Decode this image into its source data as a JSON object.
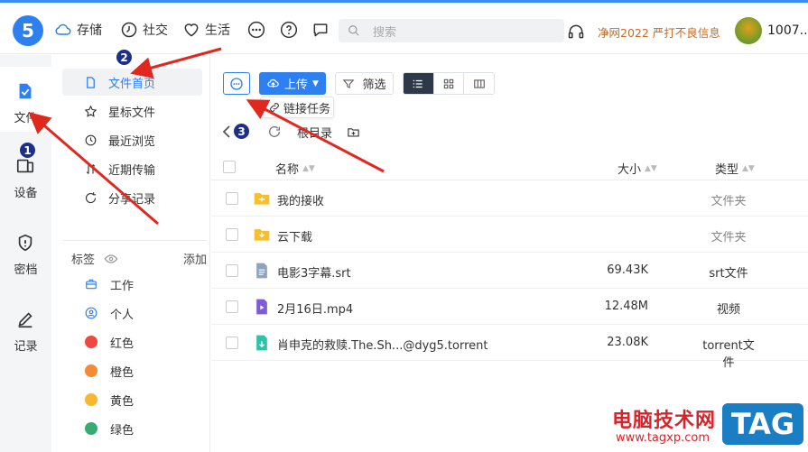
{
  "app": {
    "logo_text": "5",
    "brand_color": "#2e7ff0"
  },
  "topnav": [
    {
      "label": "存储",
      "icon": "cloud-icon"
    },
    {
      "label": "社交",
      "icon": "clock-icon"
    },
    {
      "label": "生活",
      "icon": "heart-icon"
    }
  ],
  "topicons": [
    "more-dots-icon",
    "help-icon",
    "chat-icon"
  ],
  "search": {
    "placeholder": "搜索"
  },
  "promo": "净网2022 严打不良信息",
  "user": {
    "name": "1007..."
  },
  "rail": [
    {
      "label": "文件",
      "icon": "file-icon",
      "active": true
    },
    {
      "label": "设备",
      "icon": "device-icon",
      "active": false
    },
    {
      "label": "密档",
      "icon": "shield-icon",
      "active": false
    },
    {
      "label": "记录",
      "icon": "pen-icon",
      "active": false
    }
  ],
  "menu": [
    {
      "label": "文件首页",
      "icon": "document-icon",
      "active": true
    },
    {
      "label": "星标文件",
      "icon": "star-icon",
      "active": false
    },
    {
      "label": "最近浏览",
      "icon": "history-icon",
      "active": false
    },
    {
      "label": "近期传输",
      "icon": "transfer-icon",
      "active": false
    },
    {
      "label": "分享记录",
      "icon": "share-icon",
      "active": false
    }
  ],
  "tags": {
    "title": "标签",
    "add": "添加",
    "items": [
      {
        "label": "工作",
        "icon": "briefcase-icon"
      },
      {
        "label": "个人",
        "icon": "person-icon"
      },
      {
        "label": "红色",
        "color": "#f0473f"
      },
      {
        "label": "橙色",
        "color": "#f58a35"
      },
      {
        "label": "黄色",
        "color": "#f7b731"
      },
      {
        "label": "绿色",
        "color": "#35ad72"
      }
    ]
  },
  "toolbar": {
    "upload": "上传",
    "filter": "筛选",
    "tooltip": "链接任务"
  },
  "breadcrumb": {
    "root": "根目录"
  },
  "table": {
    "headers": {
      "name": "名称",
      "size": "大小",
      "type": "类型"
    },
    "rows": [
      {
        "name": "我的接收",
        "size": "",
        "type": "文件夹",
        "icon": "folder-icon"
      },
      {
        "name": "云下载",
        "size": "",
        "type": "文件夹",
        "icon": "folder-icon"
      },
      {
        "name": "电影3字幕.srt",
        "size": "69.43K",
        "type": "srt文件",
        "icon": "srt-file-icon"
      },
      {
        "name": "2月16日.mp4",
        "size": "12.48M",
        "type": "视频",
        "icon": "video-file-icon"
      },
      {
        "name": "肖申克的救赎.The.Sh...@dyg5.torrent",
        "size": "23.08K",
        "type": "torrent文件",
        "icon": "torrent-file-icon"
      }
    ]
  },
  "annotations": {
    "badges": [
      "1",
      "2",
      "3"
    ]
  },
  "watermark": {
    "text": "电脑技术网",
    "url": "www.tagxp.com",
    "tag": "TAG"
  }
}
